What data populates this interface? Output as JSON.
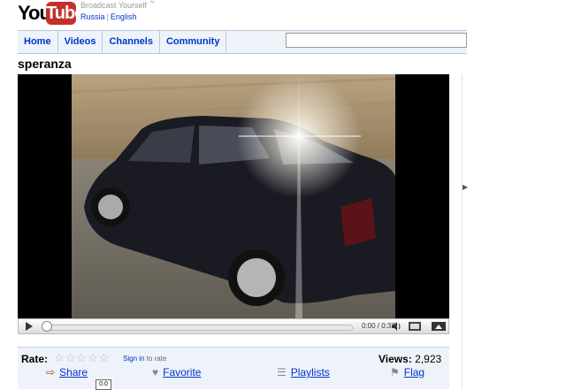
{
  "header": {
    "logo_you": "You",
    "logo_tube": "Tube",
    "tagline": "Broadcast Yourself",
    "tm": "™",
    "locale_country": "Russia",
    "locale_language": "English"
  },
  "nav": {
    "tabs": [
      "Home",
      "Videos",
      "Channels",
      "Community"
    ],
    "search_value": ""
  },
  "video": {
    "title": "speranza",
    "current_time": "0:00",
    "duration": "0:37",
    "time_display": "0:00 / 0:37",
    "progress": 0.0
  },
  "rating": {
    "label": "Rate:",
    "stars_display": "☆☆☆☆☆",
    "signin_link": "Sign in",
    "signin_suffix": " to rate",
    "views_label": "Views:",
    "views_count": "2,923"
  },
  "actions": {
    "share": "Share",
    "favorite": "Favorite",
    "playlists": "Playlists",
    "flag": "Flag"
  },
  "misc": {
    "zoom_tooltip": "0.0"
  },
  "colors": {
    "brand_red": "#c4302b",
    "link_blue": "#0033cc",
    "nav_bg": "#eef3fa"
  }
}
